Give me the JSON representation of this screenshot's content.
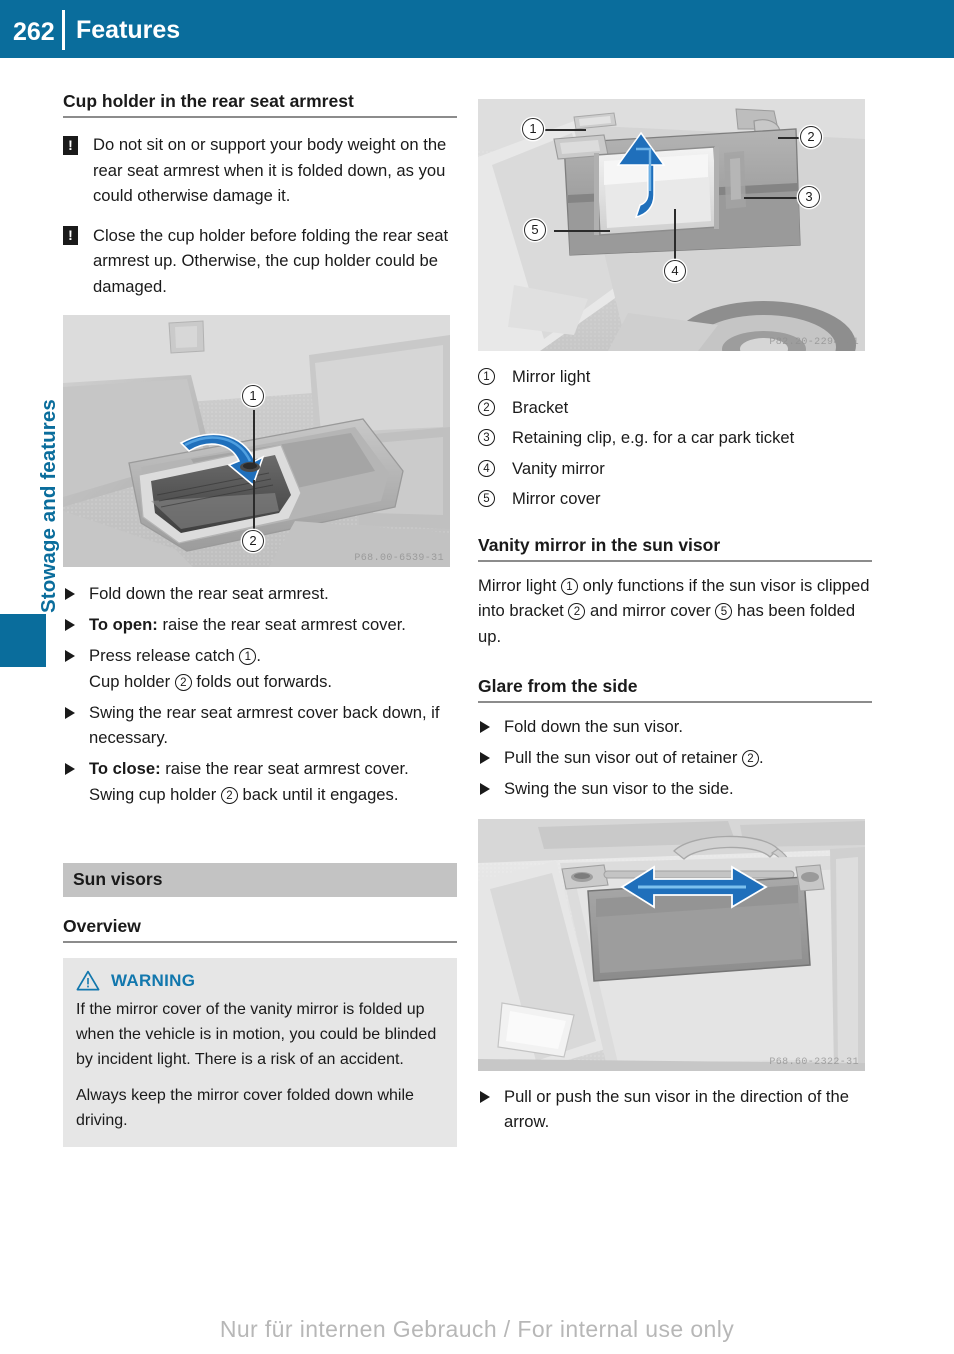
{
  "header": {
    "page_number": "262",
    "title": "Features",
    "bar_color": "#0a6d9c"
  },
  "sidebar": {
    "chapter_label": "Stowage and features",
    "tab_color": "#0a6d9c"
  },
  "left_column": {
    "heading": "Cup holder in the rear seat armrest",
    "notes": [
      {
        "icon": "exclamation-icon",
        "text": "Do not sit on or support your body weight on the rear seat armrest when it is folded down, as you could otherwise damage it."
      },
      {
        "icon": "exclamation-icon",
        "text": "Close the cup holder before folding the rear seat armrest up. Otherwise, the cup holder could be damaged."
      }
    ],
    "figure": {
      "name": "rear-seat-armrest-cup-holder-photo",
      "code": "P68.00-6539-31",
      "callouts": [
        "1",
        "2"
      ]
    },
    "steps": [
      {
        "lead": "",
        "text": "Fold down the rear seat armrest."
      },
      {
        "lead": "To open:",
        "text": "raise the rear seat armrest cover."
      },
      {
        "lead": "",
        "text": "Press release catch ①.",
        "text_parts": [
          "Press release catch ",
          "1",
          "."
        ],
        "second_line_parts": [
          "Cup holder ",
          "2",
          " folds out forwards."
        ]
      },
      {
        "lead": "",
        "text": "Swing the rear seat armrest cover back down, if necessary."
      },
      {
        "lead": "To close:",
        "text": "raise the rear seat armrest cover.",
        "second_line_parts": [
          "Swing cup holder ",
          "2",
          " back until it engages."
        ]
      }
    ],
    "section_bar": "Sun visors",
    "overview_heading": "Overview",
    "warning": {
      "label": "WARNING",
      "icon": "warning-triangle-icon",
      "label_color": "#1277ad",
      "paragraphs": [
        "If the mirror cover of the vanity mirror is folded up when the vehicle is in motion, you could be blinded by incident light. There is a risk of an accident.",
        "Always keep the mirror cover folded down while driving."
      ]
    }
  },
  "right_column": {
    "figure_top": {
      "name": "sun-visor-vanity-mirror-photo",
      "code": "P82.20-2294-31",
      "callouts": [
        "1",
        "2",
        "3",
        "4",
        "5"
      ]
    },
    "legend": [
      {
        "num": "1",
        "label": "Mirror light"
      },
      {
        "num": "2",
        "label": "Bracket"
      },
      {
        "num": "3",
        "label": "Retaining clip, e.g. for a car park ticket"
      },
      {
        "num": "4",
        "label": "Vanity mirror"
      },
      {
        "num": "5",
        "label": "Mirror cover"
      }
    ],
    "vanity_heading": "Vanity mirror in the sun visor",
    "vanity_text_parts": [
      "Mirror light ",
      "1",
      " only functions if the sun visor is clipped into bracket ",
      "2",
      " and mirror cover ",
      "5",
      " has been folded up."
    ],
    "glare_heading": "Glare from the side",
    "glare_steps": [
      {
        "text": "Fold down the sun visor."
      },
      {
        "text_parts": [
          "Pull the sun visor out of retainer ",
          "2",
          "."
        ]
      },
      {
        "text": "Swing the sun visor to the side."
      }
    ],
    "figure_bottom": {
      "name": "sun-visor-slide-photo",
      "code": "P68.60-2322-31"
    },
    "final_step": "Pull or push the sun visor in the direction of the arrow."
  },
  "footer": {
    "watermark": "Nur für internen Gebrauch / For internal use only"
  }
}
